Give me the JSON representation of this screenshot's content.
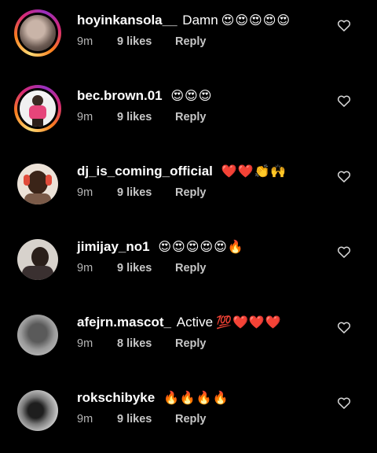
{
  "comments": [
    {
      "username": "hoyinkansola__",
      "text": "Damn",
      "emojis": "😍😍😍😍😍",
      "time": "9m",
      "likes": "9 likes",
      "reply": "Reply",
      "has_story": true,
      "avatar_colors": [
        "#6b5a52",
        "#c9b4a8"
      ]
    },
    {
      "username": "bec.brown.01",
      "text": "",
      "emojis": "😍😍😍",
      "time": "9m",
      "likes": "9 likes",
      "reply": "Reply",
      "has_story": true,
      "avatar_colors": [
        "#f4f4f4",
        "#e6457a"
      ]
    },
    {
      "username": "dj_is_coming_official",
      "text": "",
      "emojis": "❤️❤️👏🙌",
      "time": "9m",
      "likes": "9 likes",
      "reply": "Reply",
      "has_story": false,
      "avatar_colors": [
        "#e9d6c8",
        "#3b2418"
      ]
    },
    {
      "username": "jimijay_no1",
      "text": "",
      "emojis": "😍😍😍😍😍🔥",
      "time": "9m",
      "likes": "9 likes",
      "reply": "Reply",
      "has_story": false,
      "avatar_colors": [
        "#d7d2cc",
        "#2a1f1a"
      ]
    },
    {
      "username": "afejrn.mascot_",
      "text": "Active",
      "emojis": "💯❤️❤️❤️",
      "time": "9m",
      "likes": "8 likes",
      "reply": "Reply",
      "has_story": false,
      "avatar_colors": [
        "#9a9a9a",
        "#3a3a3a"
      ]
    },
    {
      "username": "rokschibyke",
      "text": "",
      "emojis": "🔥🔥🔥🔥",
      "time": "9m",
      "likes": "9 likes",
      "reply": "Reply",
      "has_story": false,
      "avatar_colors": [
        "#dcdcdc",
        "#1e1e1e"
      ]
    }
  ],
  "icons": {
    "like": "heart-outline-icon"
  },
  "colors": {
    "background": "#000000",
    "meta_text": "#b7b7b7",
    "heart_stroke": "#d9d9d9"
  }
}
